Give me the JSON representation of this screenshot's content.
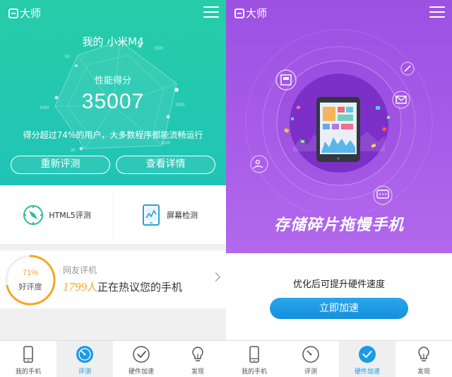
{
  "left": {
    "header": {
      "logo_text": "大师"
    },
    "hero": {
      "device_title": "我的 小米M4",
      "score_label": "性能得分",
      "score": "35007",
      "description": "得分超过74%的用户，大多数程序都能流畅运行",
      "radar_ticks": [
        "1500",
        "1000",
        "1000",
        "1000",
        "30",
        "90"
      ],
      "retest_button": "重新评测",
      "details_button": "查看详情"
    },
    "tools": {
      "html5_label": "HTML5评测",
      "screen_label": "屏幕检测"
    },
    "rating": {
      "percent": "71%",
      "percent_value": 0.71,
      "label": "好评度",
      "title": "网友评机",
      "count": "1799",
      "unit": "人",
      "suffix": "正在热议您的手机"
    }
  },
  "right": {
    "header": {
      "logo_text": "大师"
    },
    "banner_title": "存储碎片拖慢手机",
    "optimize_text": "优化后可提升硬件速度",
    "accelerate_button": "立即加速"
  },
  "nav": {
    "my_phone": "我的手机",
    "evaluate": "评测",
    "hardware_accel": "硬件加速",
    "discover": "发现"
  },
  "colors": {
    "green": "#22c7b1",
    "purple": "#a457e6",
    "accent_blue": "#1a9be6",
    "orange": "#f5a623"
  },
  "icons": [
    "menu-icon",
    "compass-icon",
    "screen-check-icon",
    "phone-icon",
    "speedometer-icon",
    "checkmark-icon",
    "lightbulb-icon",
    "tablet-icon",
    "image-icon",
    "mail-icon",
    "pencil-icon",
    "chat-icon",
    "picture-icon"
  ]
}
